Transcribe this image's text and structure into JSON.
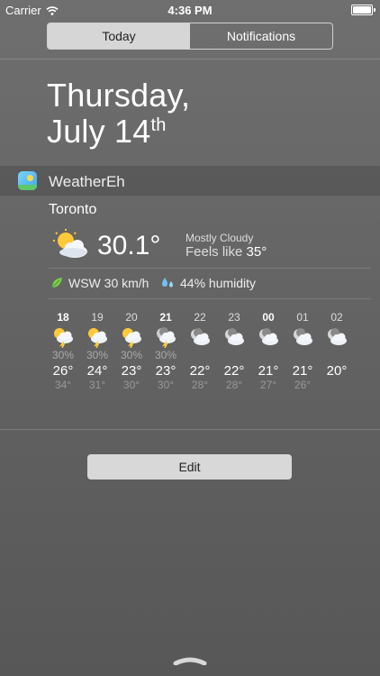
{
  "status_bar": {
    "carrier": "Carrier",
    "time": "4:36 PM"
  },
  "segments": [
    {
      "label": "Today",
      "active": true
    },
    {
      "label": "Notifications",
      "active": false
    }
  ],
  "date": {
    "line1": "Thursday,",
    "line2_main": "July 14",
    "line2_suffix": "th"
  },
  "widget": {
    "app_name": "WeatherEh",
    "city": "Toronto",
    "current_temp": "30.1°",
    "condition": "Mostly Cloudy",
    "feels_label": "Feels like ",
    "feels_value": "35°",
    "wind": "WSW 30 km/h",
    "humidity": "44% humidity"
  },
  "hourly": [
    {
      "hour": "18",
      "bold": true,
      "icon": "sun-cloud-storm-icon",
      "pop": "30%",
      "temp": "26°",
      "feels": "34°"
    },
    {
      "hour": "19",
      "bold": false,
      "icon": "sun-cloud-storm-icon",
      "pop": "30%",
      "temp": "24°",
      "feels": "31°"
    },
    {
      "hour": "20",
      "bold": false,
      "icon": "sun-cloud-storm-icon",
      "pop": "30%",
      "temp": "23°",
      "feels": "30°"
    },
    {
      "hour": "21",
      "bold": true,
      "icon": "moon-cloud-storm-icon",
      "pop": "30%",
      "temp": "23°",
      "feels": "30°"
    },
    {
      "hour": "22",
      "bold": false,
      "icon": "moon-cloud-icon",
      "pop": "",
      "temp": "22°",
      "feels": "28°"
    },
    {
      "hour": "23",
      "bold": false,
      "icon": "moon-cloud-icon",
      "pop": "",
      "temp": "22°",
      "feels": "28°"
    },
    {
      "hour": "00",
      "bold": true,
      "icon": "moon-cloud-icon",
      "pop": "",
      "temp": "21°",
      "feels": "27°"
    },
    {
      "hour": "01",
      "bold": false,
      "icon": "moon-cloud-icon",
      "pop": "",
      "temp": "21°",
      "feels": "26°"
    },
    {
      "hour": "02",
      "bold": false,
      "icon": "moon-cloud-icon",
      "pop": "",
      "temp": "20°",
      "feels": ""
    }
  ],
  "edit_label": "Edit"
}
